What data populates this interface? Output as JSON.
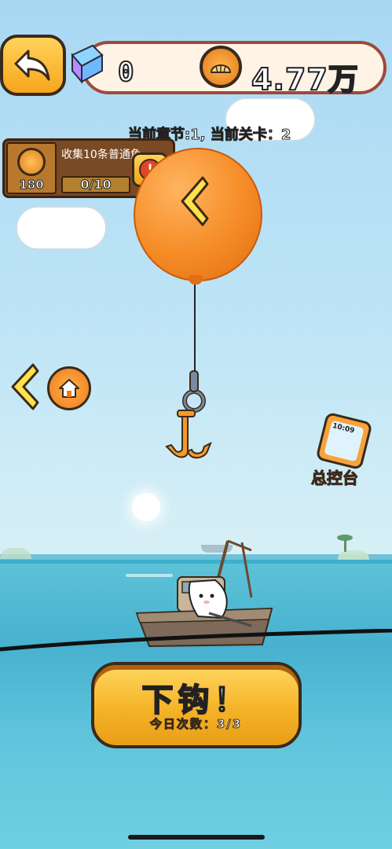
{
  "header": {
    "gem_count": "0",
    "coin_amount": "4.77万"
  },
  "level_info": "当前章节:1, 当前关卡：2",
  "quest": {
    "title": "收集10条普通鱼",
    "reward": "180",
    "progress": "0/10",
    "progress_fraction": 0.0,
    "alert_symbol": "!"
  },
  "console": {
    "label": "总控台",
    "phone_time": "10:09"
  },
  "cast_button": {
    "label": "下钩！",
    "sub_label": "今日次数：3/3"
  },
  "colors": {
    "accent_orange": "#f58b25",
    "button_yellow": "#f5b327",
    "sea": "#47b1cf"
  },
  "icons": {
    "back": "back-arrow-icon",
    "gem": "gem-stack-icon",
    "coin": "shell-coin-icon",
    "home": "home-icon",
    "left": "chevron-left-icon",
    "alert": "alert-icon"
  }
}
